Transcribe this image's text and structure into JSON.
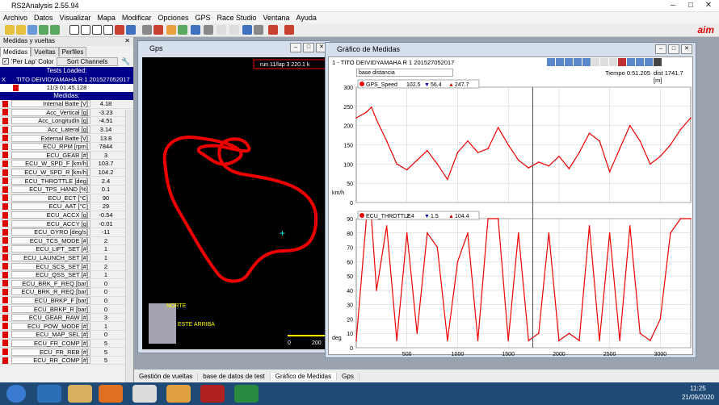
{
  "app": {
    "title": "RS2Analysis 2.55.94"
  },
  "menu": [
    "Archivo",
    "Datos",
    "Visualizar",
    "Mapa",
    "Modificar",
    "Opciones",
    "GPS",
    "Race Studio",
    "Ventana",
    "Ayuda"
  ],
  "left_panel": {
    "header": "Medidas y vueltas",
    "tabs": [
      "Medidas",
      "Vueltas",
      "Perfiles"
    ],
    "per_lap_label": "'Per Lap' Color",
    "sort_label": "Sort Channels",
    "tests_loaded": "Tests Loaded:",
    "test_name": "TITO DEIVIDYAMAHA R 1 201527052017",
    "test_time": "11/3 01.45.128",
    "medidas_header": "Medidas:",
    "measures": [
      {
        "name": "Internal Batte [V]",
        "value": "4.18"
      },
      {
        "name": "Acc_Vertical [g]",
        "value": "-3.23"
      },
      {
        "name": "Acc_Longitudin [g]",
        "value": "-4.51"
      },
      {
        "name": "Acc_Lateral [g]",
        "value": "3.14"
      },
      {
        "name": "External Batte [V]",
        "value": "13.8"
      },
      {
        "name": "ECU_RPM [rpm]",
        "value": "7844"
      },
      {
        "name": "ECU_GEAR [#]",
        "value": "3"
      },
      {
        "name": "ECU_W_SPD_F [km/h]",
        "value": "103.7"
      },
      {
        "name": "ECU_W_SPD_R [km/h]",
        "value": "104.2"
      },
      {
        "name": "ECU_THROTTLE [deg]",
        "value": "2.4"
      },
      {
        "name": "ECU_TPS_HAND [%]",
        "value": "0.1"
      },
      {
        "name": "ECU_ECT [°C]",
        "value": "90"
      },
      {
        "name": "ECU_AAT [°C]",
        "value": "29"
      },
      {
        "name": "ECU_ACCX [g]",
        "value": "-0.54"
      },
      {
        "name": "ECU_ACCY [g]",
        "value": "-0.01"
      },
      {
        "name": "ECU_GYRO [deg/s]",
        "value": "-11"
      },
      {
        "name": "ECU_TCS_MODE [#]",
        "value": "2"
      },
      {
        "name": "ECU_LIFT_SET [#]",
        "value": "1"
      },
      {
        "name": "ECU_LAUNCH_SET [#]",
        "value": "1"
      },
      {
        "name": "ECU_SCS_SET [#]",
        "value": "2"
      },
      {
        "name": "ECU_QSS_SET [#]",
        "value": "1"
      },
      {
        "name": "ECU_BRK_F_REQ [bar]",
        "value": "0"
      },
      {
        "name": "ECU_BRK_R_REQ [bar]",
        "value": "0"
      },
      {
        "name": "ECU_BRKP_F [bar]",
        "value": "0"
      },
      {
        "name": "ECU_BRKP_R [bar]",
        "value": "0"
      },
      {
        "name": "ECU_GEAR_RAW [#]",
        "value": "3"
      },
      {
        "name": "ECU_POW_MODE [#]",
        "value": "1"
      },
      {
        "name": "ECU_MAP_SEL [#]",
        "value": "0"
      },
      {
        "name": "ECU_FR_COMP [#]",
        "value": "5"
      },
      {
        "name": "ECU_FR_REB [#]",
        "value": "5"
      },
      {
        "name": "ECU_RR_COMP [#]",
        "value": "5"
      }
    ]
  },
  "gps_window": {
    "title": "Gps",
    "info": "run 11/lap 3 220.1 k",
    "norte": "NORTE",
    "arriba": "ESTE ARRIBA",
    "scale_0": "0",
    "scale_200": "200"
  },
  "chart_window": {
    "title": "Gráfico de Medidas",
    "test_label": "1 - TITO DEIVIDYAMAHA R 1 201527052017",
    "base_label": "base distancia",
    "tiempo": "Tiempo 0:51.205",
    "dist": "dist 1741.7 [m]",
    "unit_top": "km/h",
    "unit_bottom": "deg"
  },
  "chart_data": [
    {
      "type": "line",
      "series": [
        {
          "name": "GPS_Speed",
          "cursor": "102.5",
          "min": "56.4",
          "max": "247.7"
        }
      ],
      "ylim": [
        0,
        300
      ],
      "yticks": [
        "300",
        "250",
        "200",
        "150",
        "100",
        "50",
        "0"
      ],
      "x": [
        0,
        100,
        150,
        200,
        300,
        400,
        500,
        600,
        700,
        800,
        900,
        1000,
        1100,
        1200,
        1300,
        1400,
        1500,
        1600,
        1700,
        1800,
        1900,
        2000,
        2100,
        2200,
        2300,
        2400,
        2500,
        2600,
        2700,
        2800,
        2900,
        3000,
        3100,
        3200,
        3300
      ],
      "values": [
        220,
        235,
        248,
        215,
        160,
        100,
        85,
        110,
        135,
        100,
        60,
        130,
        160,
        130,
        140,
        195,
        150,
        110,
        90,
        105,
        95,
        120,
        88,
        130,
        180,
        160,
        80,
        140,
        200,
        160,
        100,
        120,
        150,
        190,
        220
      ],
      "ylabel": "km/h"
    },
    {
      "type": "line",
      "series": [
        {
          "name": "ECU_THROTTLE",
          "cursor": "2.4",
          "min": "1.5",
          "max": "104.4"
        }
      ],
      "ylim": [
        0,
        90
      ],
      "yticks": [
        "90",
        "80",
        "70",
        "60",
        "50",
        "40",
        "30",
        "20",
        "10",
        "0"
      ],
      "xticks": [
        "500",
        "1000",
        "1500",
        "2000",
        "2500",
        "3000"
      ],
      "x": [
        0,
        100,
        150,
        200,
        300,
        400,
        500,
        600,
        700,
        800,
        900,
        1000,
        1100,
        1200,
        1300,
        1400,
        1500,
        1600,
        1700,
        1800,
        1900,
        2000,
        2100,
        2200,
        2300,
        2400,
        2500,
        2600,
        2700,
        2800,
        2900,
        3000,
        3100,
        3200,
        3300
      ],
      "values": [
        5,
        90,
        90,
        40,
        85,
        5,
        80,
        10,
        80,
        70,
        5,
        60,
        80,
        5,
        90,
        90,
        5,
        80,
        5,
        10,
        80,
        5,
        10,
        5,
        85,
        5,
        80,
        5,
        85,
        10,
        5,
        20,
        80,
        90,
        90
      ],
      "ylabel": "deg"
    }
  ],
  "bottom_tabs": [
    "Gestión de vueltas",
    "base de datos de test",
    "Gráfico de Medidas",
    "Gps"
  ],
  "clock": {
    "time": "11:25",
    "date": "21/09/2020"
  }
}
